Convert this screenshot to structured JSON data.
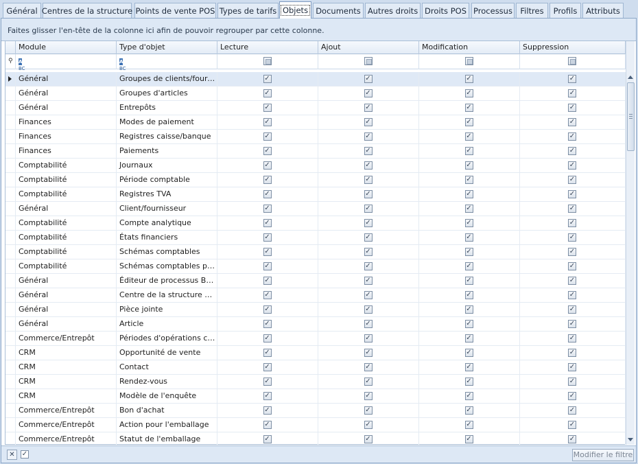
{
  "tabs": [
    {
      "label": "Général",
      "active": false
    },
    {
      "label": "Centres de la structure",
      "active": false
    },
    {
      "label": "Points de vente POS",
      "active": false
    },
    {
      "label": "Types de tarifs",
      "active": false
    },
    {
      "label": "Objets",
      "active": true
    },
    {
      "label": "Documents",
      "active": false
    },
    {
      "label": "Autres droits",
      "active": false
    },
    {
      "label": "Droits POS",
      "active": false
    },
    {
      "label": "Processus",
      "active": false
    },
    {
      "label": "Filtres",
      "active": false
    },
    {
      "label": "Profils",
      "active": false
    },
    {
      "label": "Attributs",
      "active": false
    }
  ],
  "group_panel": {
    "hint": "Faites glisser l'en-tête de la colonne ici afin de pouvoir regrouper par cette colonne."
  },
  "columns": [
    "Module",
    "Type d'objet",
    "Lecture",
    "Ajout",
    "Modification",
    "Suppression"
  ],
  "filter_row": {
    "text_filter_icon": "abc-filter-icon",
    "checkbox_state": "indeterminate"
  },
  "rows": [
    {
      "module": "Général",
      "type": "Groupes de clients/fourn...",
      "checks": [
        true,
        true,
        true,
        true
      ]
    },
    {
      "module": "Général",
      "type": "Groupes d'articles",
      "checks": [
        true,
        true,
        true,
        true
      ]
    },
    {
      "module": "Général",
      "type": "Entrepôts",
      "checks": [
        true,
        true,
        true,
        true
      ]
    },
    {
      "module": "Finances",
      "type": "Modes de paiement",
      "checks": [
        true,
        true,
        true,
        true
      ]
    },
    {
      "module": "Finances",
      "type": "Registres caisse/banque",
      "checks": [
        true,
        true,
        true,
        true
      ]
    },
    {
      "module": "Finances",
      "type": "Paiements",
      "checks": [
        true,
        true,
        true,
        true
      ]
    },
    {
      "module": "Comptabilité",
      "type": "Journaux",
      "checks": [
        true,
        true,
        true,
        true
      ]
    },
    {
      "module": "Comptabilité",
      "type": "Période comptable",
      "checks": [
        true,
        true,
        true,
        true
      ]
    },
    {
      "module": "Comptabilité",
      "type": "Registres TVA",
      "checks": [
        true,
        true,
        true,
        true
      ]
    },
    {
      "module": "Général",
      "type": "Client/fournisseur",
      "checks": [
        true,
        true,
        true,
        true
      ]
    },
    {
      "module": "Comptabilité",
      "type": "Compte analytique",
      "checks": [
        true,
        true,
        true,
        true
      ]
    },
    {
      "module": "Comptabilité",
      "type": "États financiers",
      "checks": [
        true,
        true,
        true,
        true
      ]
    },
    {
      "module": "Comptabilité",
      "type": "Schémas comptables",
      "checks": [
        true,
        true,
        true,
        true
      ]
    },
    {
      "module": "Comptabilité",
      "type": "Schémas comptables péri...",
      "checks": [
        true,
        true,
        true,
        true
      ]
    },
    {
      "module": "Général",
      "type": "Éditeur de processus BPM",
      "checks": [
        true,
        true,
        true,
        true
      ]
    },
    {
      "module": "Général",
      "type": "Centre de la structure de...",
      "checks": [
        true,
        true,
        true,
        true
      ]
    },
    {
      "module": "Général",
      "type": "Pièce jointe",
      "checks": [
        true,
        true,
        true,
        true
      ]
    },
    {
      "module": "Général",
      "type": "Article",
      "checks": [
        true,
        true,
        true,
        true
      ]
    },
    {
      "module": "Commerce/Entrepôt",
      "type": "Périodes d'opérations co...",
      "checks": [
        true,
        true,
        true,
        true
      ]
    },
    {
      "module": "CRM",
      "type": "Opportunité de vente",
      "checks": [
        true,
        true,
        true,
        true
      ]
    },
    {
      "module": "CRM",
      "type": "Contact",
      "checks": [
        true,
        true,
        true,
        true
      ]
    },
    {
      "module": "CRM",
      "type": "Rendez-vous",
      "checks": [
        true,
        true,
        true,
        true
      ]
    },
    {
      "module": "CRM",
      "type": "Modèle de l'enquête",
      "checks": [
        true,
        true,
        true,
        true
      ]
    },
    {
      "module": "Commerce/Entrepôt",
      "type": "Bon d'achat",
      "checks": [
        true,
        true,
        true,
        true
      ]
    },
    {
      "module": "Commerce/Entrepôt",
      "type": "Action pour l'emballage",
      "checks": [
        true,
        true,
        true,
        true
      ]
    },
    {
      "module": "Commerce/Entrepôt",
      "type": "Statut de l'emballage",
      "checks": [
        true,
        true,
        true,
        true
      ]
    }
  ],
  "selected_row": 0,
  "footer": {
    "clear_filter_glyph": "✕",
    "filter_enabled": true,
    "edit_filter_label": "Modifier le filtre"
  },
  "colors": {
    "accent": "#3e73b5",
    "selection": "#dfe9f6",
    "background": "#cfddee"
  }
}
